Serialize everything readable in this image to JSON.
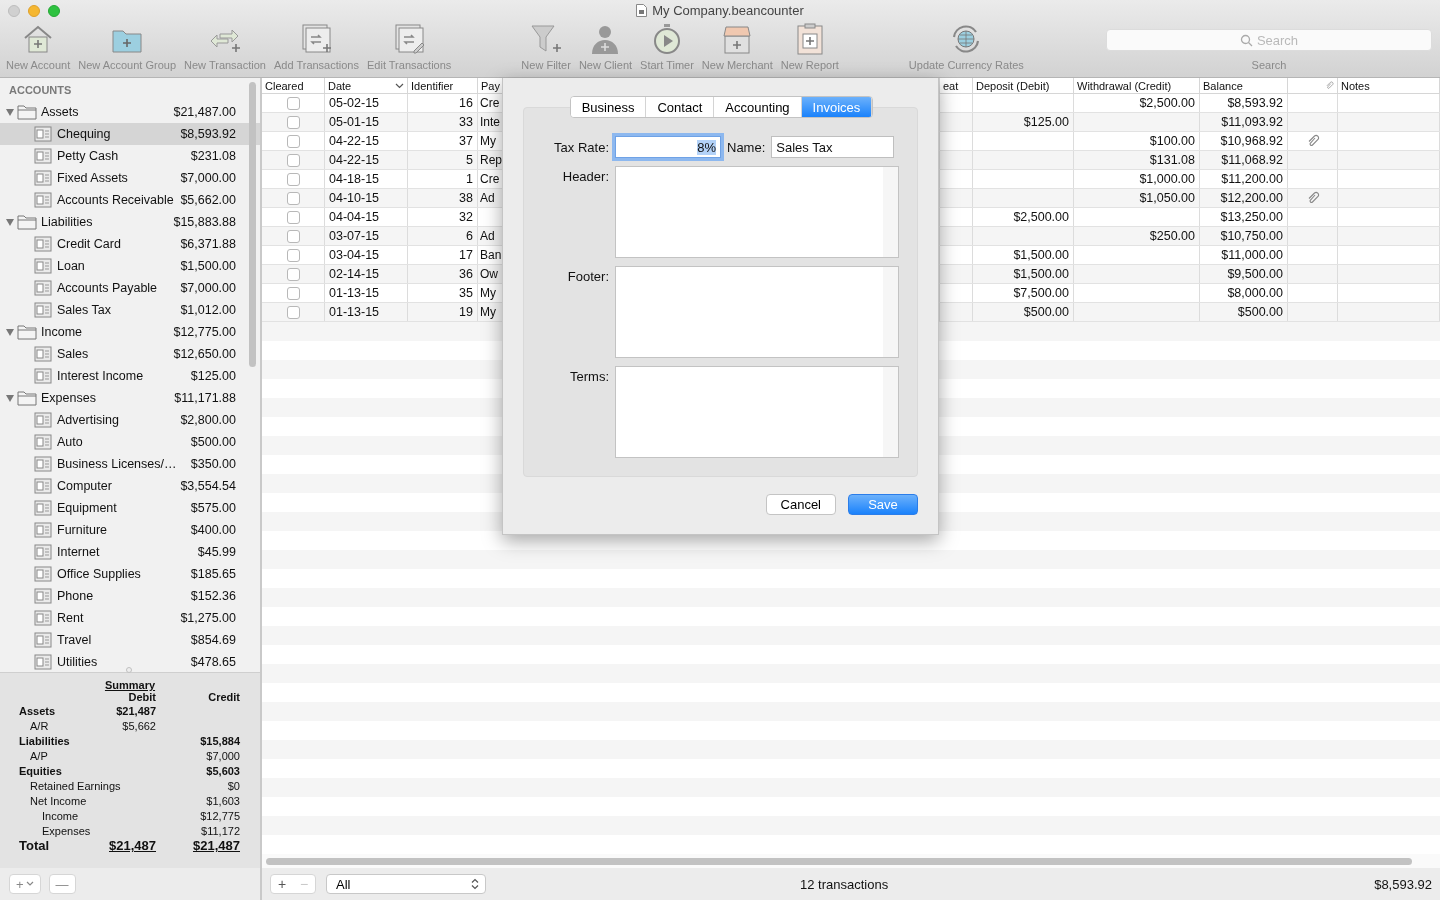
{
  "window": {
    "title": "My Company.beancounter"
  },
  "toolbar": {
    "groups": [
      [
        {
          "label": "New Account"
        },
        {
          "label": "New Account Group"
        },
        {
          "label": "New Transaction"
        },
        {
          "label": "Add Transactions"
        },
        {
          "label": "Edit Transactions"
        }
      ],
      [
        {
          "label": "New Filter"
        },
        {
          "label": "New Client"
        },
        {
          "label": "Start Timer"
        },
        {
          "label": "New Merchant"
        },
        {
          "label": "New Report"
        }
      ],
      [
        {
          "label": "Update Currency Rates"
        }
      ]
    ],
    "search": {
      "placeholder": "Search",
      "label": "Search"
    }
  },
  "sidebar": {
    "heading": "ACCOUNTS",
    "items": [
      {
        "name": "Assets",
        "balance": "$21,487.00",
        "expanded": true,
        "selected": false,
        "children": [
          {
            "name": "Chequing",
            "balance": "$8,593.92",
            "selected": true
          },
          {
            "name": "Petty Cash",
            "balance": "$231.08",
            "selected": false
          },
          {
            "name": "Fixed Assets",
            "balance": "$7,000.00",
            "selected": false
          },
          {
            "name": "Accounts Receivable",
            "balance": "$5,662.00",
            "selected": false
          }
        ]
      },
      {
        "name": "Liabilities",
        "balance": "$15,883.88",
        "expanded": true,
        "selected": false,
        "children": [
          {
            "name": "Credit Card",
            "balance": "$6,371.88",
            "selected": false
          },
          {
            "name": "Loan",
            "balance": "$1,500.00",
            "selected": false
          },
          {
            "name": "Accounts Payable",
            "balance": "$7,000.00",
            "selected": false
          },
          {
            "name": "Sales Tax",
            "balance": "$1,012.00",
            "selected": false
          }
        ]
      },
      {
        "name": "Income",
        "balance": "$12,775.00",
        "expanded": true,
        "selected": false,
        "children": [
          {
            "name": "Sales",
            "balance": "$12,650.00",
            "selected": false
          },
          {
            "name": "Interest Income",
            "balance": "$125.00",
            "selected": false
          }
        ]
      },
      {
        "name": "Expenses",
        "balance": "$11,171.88",
        "expanded": true,
        "selected": false,
        "children": [
          {
            "name": "Advertising",
            "balance": "$2,800.00",
            "selected": false
          },
          {
            "name": "Auto",
            "balance": "$500.00",
            "selected": false
          },
          {
            "name": "Business Licenses/…",
            "balance": "$350.00",
            "selected": false
          },
          {
            "name": "Computer",
            "balance": "$3,554.54",
            "selected": false
          },
          {
            "name": "Equipment",
            "balance": "$575.00",
            "selected": false
          },
          {
            "name": "Furniture",
            "balance": "$400.00",
            "selected": false
          },
          {
            "name": "Internet",
            "balance": "$45.99",
            "selected": false
          },
          {
            "name": "Office Supplies",
            "balance": "$185.65",
            "selected": false
          },
          {
            "name": "Phone",
            "balance": "$152.36",
            "selected": false
          },
          {
            "name": "Rent",
            "balance": "$1,275.00",
            "selected": false
          },
          {
            "name": "Travel",
            "balance": "$854.69",
            "selected": false
          },
          {
            "name": "Utilities",
            "balance": "$478.65",
            "selected": false
          }
        ]
      }
    ]
  },
  "summary": {
    "title": "Summary",
    "columns": [
      "Debit",
      "Credit"
    ],
    "rows": [
      {
        "kind": "line",
        "label": "Assets",
        "debit": "$21,487",
        "children": [
          {
            "label": "A/R",
            "debit": "$5,662"
          }
        ]
      },
      {
        "kind": "line",
        "label": "Liabilities",
        "credit": "$15,884",
        "children": [
          {
            "label": "A/P",
            "credit": "$7,000"
          }
        ]
      },
      {
        "kind": "line",
        "label": "Equities",
        "credit": "$5,603",
        "children": [
          {
            "label": "Retained Earnings",
            "credit": "$0"
          },
          {
            "label": "Net Income",
            "credit": "$1,603",
            "children": [
              {
                "label": "Income",
                "credit": "$12,775"
              },
              {
                "label": "Expenses",
                "credit": "$11,172"
              }
            ]
          }
        ]
      },
      {
        "kind": "total",
        "label": "Total",
        "debit": "$21,487",
        "credit": "$21,487"
      }
    ]
  },
  "sidebar_buttons": [
    {
      "label": "+",
      "dropdown": true
    },
    {
      "label": "—",
      "dropdown": false
    }
  ],
  "table": {
    "columns": [
      {
        "kind": "text",
        "label": "Cleared",
        "sorted": false
      },
      {
        "kind": "text",
        "label": "Date",
        "sorted": true
      },
      {
        "kind": "text",
        "label": "Identifier",
        "sorted": false
      },
      {
        "kind": "text",
        "label": "Pay",
        "sorted": false
      },
      {
        "kind": "hidden"
      },
      {
        "kind": "text",
        "label": "eat",
        "sorted": false
      },
      {
        "kind": "text",
        "label": "Deposit (Debit)",
        "sorted": false
      },
      {
        "kind": "text",
        "label": "Withdrawal (Credit)",
        "sorted": false
      },
      {
        "kind": "text",
        "label": "Balance",
        "sorted": false
      },
      {
        "kind": "attachment"
      },
      {
        "kind": "text",
        "label": "Notes",
        "sorted": false
      }
    ],
    "rows": [
      {
        "cleared": false,
        "date": "05-02-15",
        "identifier": "16",
        "payee": "Cre",
        "withdrawal": "$2,500.00",
        "balance": "$8,593.92",
        "attachment": false
      },
      {
        "cleared": false,
        "date": "05-01-15",
        "identifier": "33",
        "payee": "Inte",
        "deposit": "$125.00",
        "balance": "$11,093.92",
        "attachment": false
      },
      {
        "cleared": false,
        "date": "04-22-15",
        "identifier": "37",
        "payee": "My",
        "withdrawal": "$100.00",
        "balance": "$10,968.92",
        "attachment": true
      },
      {
        "cleared": false,
        "date": "04-22-15",
        "identifier": "5",
        "payee": "Rep",
        "withdrawal": "$131.08",
        "balance": "$11,068.92",
        "attachment": false
      },
      {
        "cleared": false,
        "date": "04-18-15",
        "identifier": "1",
        "payee": "Cre",
        "withdrawal": "$1,000.00",
        "balance": "$11,200.00",
        "attachment": false
      },
      {
        "cleared": false,
        "date": "04-10-15",
        "identifier": "38",
        "payee": "Ad",
        "withdrawal": "$1,050.00",
        "balance": "$12,200.00",
        "attachment": true
      },
      {
        "cleared": false,
        "date": "04-04-15",
        "identifier": "32",
        "deposit": "$2,500.00",
        "balance": "$13,250.00",
        "attachment": false
      },
      {
        "cleared": false,
        "date": "03-07-15",
        "identifier": "6",
        "payee": "Ad",
        "withdrawal": "$250.00",
        "balance": "$10,750.00",
        "attachment": false
      },
      {
        "cleared": false,
        "date": "03-04-15",
        "identifier": "17",
        "payee": "Ban",
        "deposit": "$1,500.00",
        "balance": "$11,000.00",
        "attachment": false
      },
      {
        "cleared": false,
        "date": "02-14-15",
        "identifier": "36",
        "payee": "Ow",
        "deposit": "$1,500.00",
        "balance": "$9,500.00",
        "attachment": false
      },
      {
        "cleared": false,
        "date": "01-13-15",
        "identifier": "35",
        "payee": "My",
        "deposit": "$7,500.00",
        "balance": "$8,000.00",
        "attachment": false
      },
      {
        "cleared": false,
        "date": "01-13-15",
        "identifier": "19",
        "payee": "My",
        "deposit": "$500.00",
        "balance": "$500.00",
        "attachment": false
      }
    ]
  },
  "table_bar": {
    "buttons": [
      {
        "label": "+",
        "disabled": false
      },
      {
        "label": "−",
        "disabled": true
      }
    ],
    "filter": "All",
    "count": "12 transactions",
    "total": "$8,593.92"
  },
  "dialog": {
    "tabs": [
      {
        "label": "Business",
        "selected": false
      },
      {
        "label": "Contact",
        "selected": false
      },
      {
        "label": "Accounting",
        "selected": false
      },
      {
        "label": "Invoices",
        "selected": true
      }
    ],
    "fields": [
      {
        "label": "Tax Rate:",
        "value": "8%",
        "focused": true
      },
      {
        "label": "Name:",
        "value": "Sales Tax",
        "focused": false
      }
    ],
    "text_areas": [
      {
        "label": "Header:"
      },
      {
        "label": "Footer:"
      },
      {
        "label": "Terms:"
      }
    ],
    "buttons": [
      {
        "label": "Cancel",
        "default": false
      },
      {
        "label": "Save",
        "default": true
      }
    ]
  }
}
